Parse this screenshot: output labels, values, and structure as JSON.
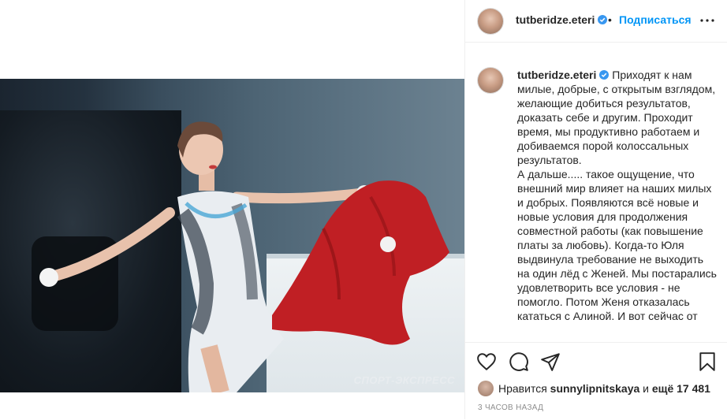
{
  "post": {
    "username": "tutberidze.eteri",
    "follow_label": "Подписаться",
    "separator": "•",
    "photo_watermark": "СПОРТ-ЭКСПРЕСС",
    "caption_text": "Приходят к нам милые, добрые, с открытым взглядом, желающие добиться результатов, доказать себе и другим. Проходит время, мы продуктивно работаем и добиваемся порой колоссальных результатов.\nА дальше..... такое ощущение, что внешний мир влияет на наших милых и добрых. Появляются всё новые и новые условия для продолжения совместной работы (как повышение платы за любовь). Когда-то Юля выдвинула требование не выходить на один лёд с Женей. Мы постарались удовлетворить все условия - не помогло. Потом Женя отказалась кататься с Алиной. И вот сейчас от",
    "likes_prefix": "Нравится",
    "likes_user": "sunnylipnitskaya",
    "likes_and": "и",
    "likes_more": "ещё 17 481",
    "time_ago": "3 ЧАСОВ НАЗАД"
  },
  "icons": {
    "verified": "verified-badge-icon",
    "more": "more-options-icon",
    "like": "heart-icon",
    "comment": "comment-icon",
    "share": "share-icon",
    "save": "bookmark-icon"
  },
  "colors": {
    "accent": "#0095f6",
    "text": "#262626",
    "muted": "#8e8e8e",
    "border": "#efefef"
  }
}
